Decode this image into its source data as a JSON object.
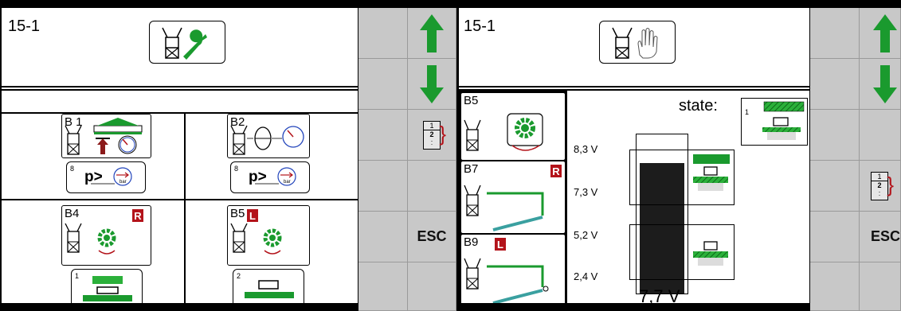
{
  "left": {
    "title": "15-1",
    "tiles": [
      {
        "label": "B 1",
        "sub_num": "8",
        "sub_text": "p>",
        "sub_unit": "bar"
      },
      {
        "label": "B2",
        "sub_num": "8",
        "sub_text": "p>",
        "sub_unit": "bar"
      },
      {
        "label": "B4",
        "badge": "R",
        "sub_num": "1"
      },
      {
        "label": "B5",
        "badge": "L",
        "sub_num": "2"
      }
    ]
  },
  "right": {
    "title": "15-1",
    "list": [
      {
        "label": "B5"
      },
      {
        "label": "B7",
        "badge": "R"
      },
      {
        "label": "B9",
        "badge": "L"
      }
    ],
    "state_label": "state:",
    "state_num": "1",
    "voltages": [
      "8,3 V",
      "7,3 V",
      "5,2 V",
      "2,4 V"
    ],
    "current_value": "7,7 V",
    "level_fraction": 0.82
  },
  "softkeys": {
    "esc": "ESC",
    "page": [
      "1",
      "2",
      ":"
    ]
  },
  "colors": {
    "green": "#1a9a2e",
    "darkred": "#b3131a",
    "bar": "#1c1c1c",
    "softkey": "#c8c8c8"
  }
}
